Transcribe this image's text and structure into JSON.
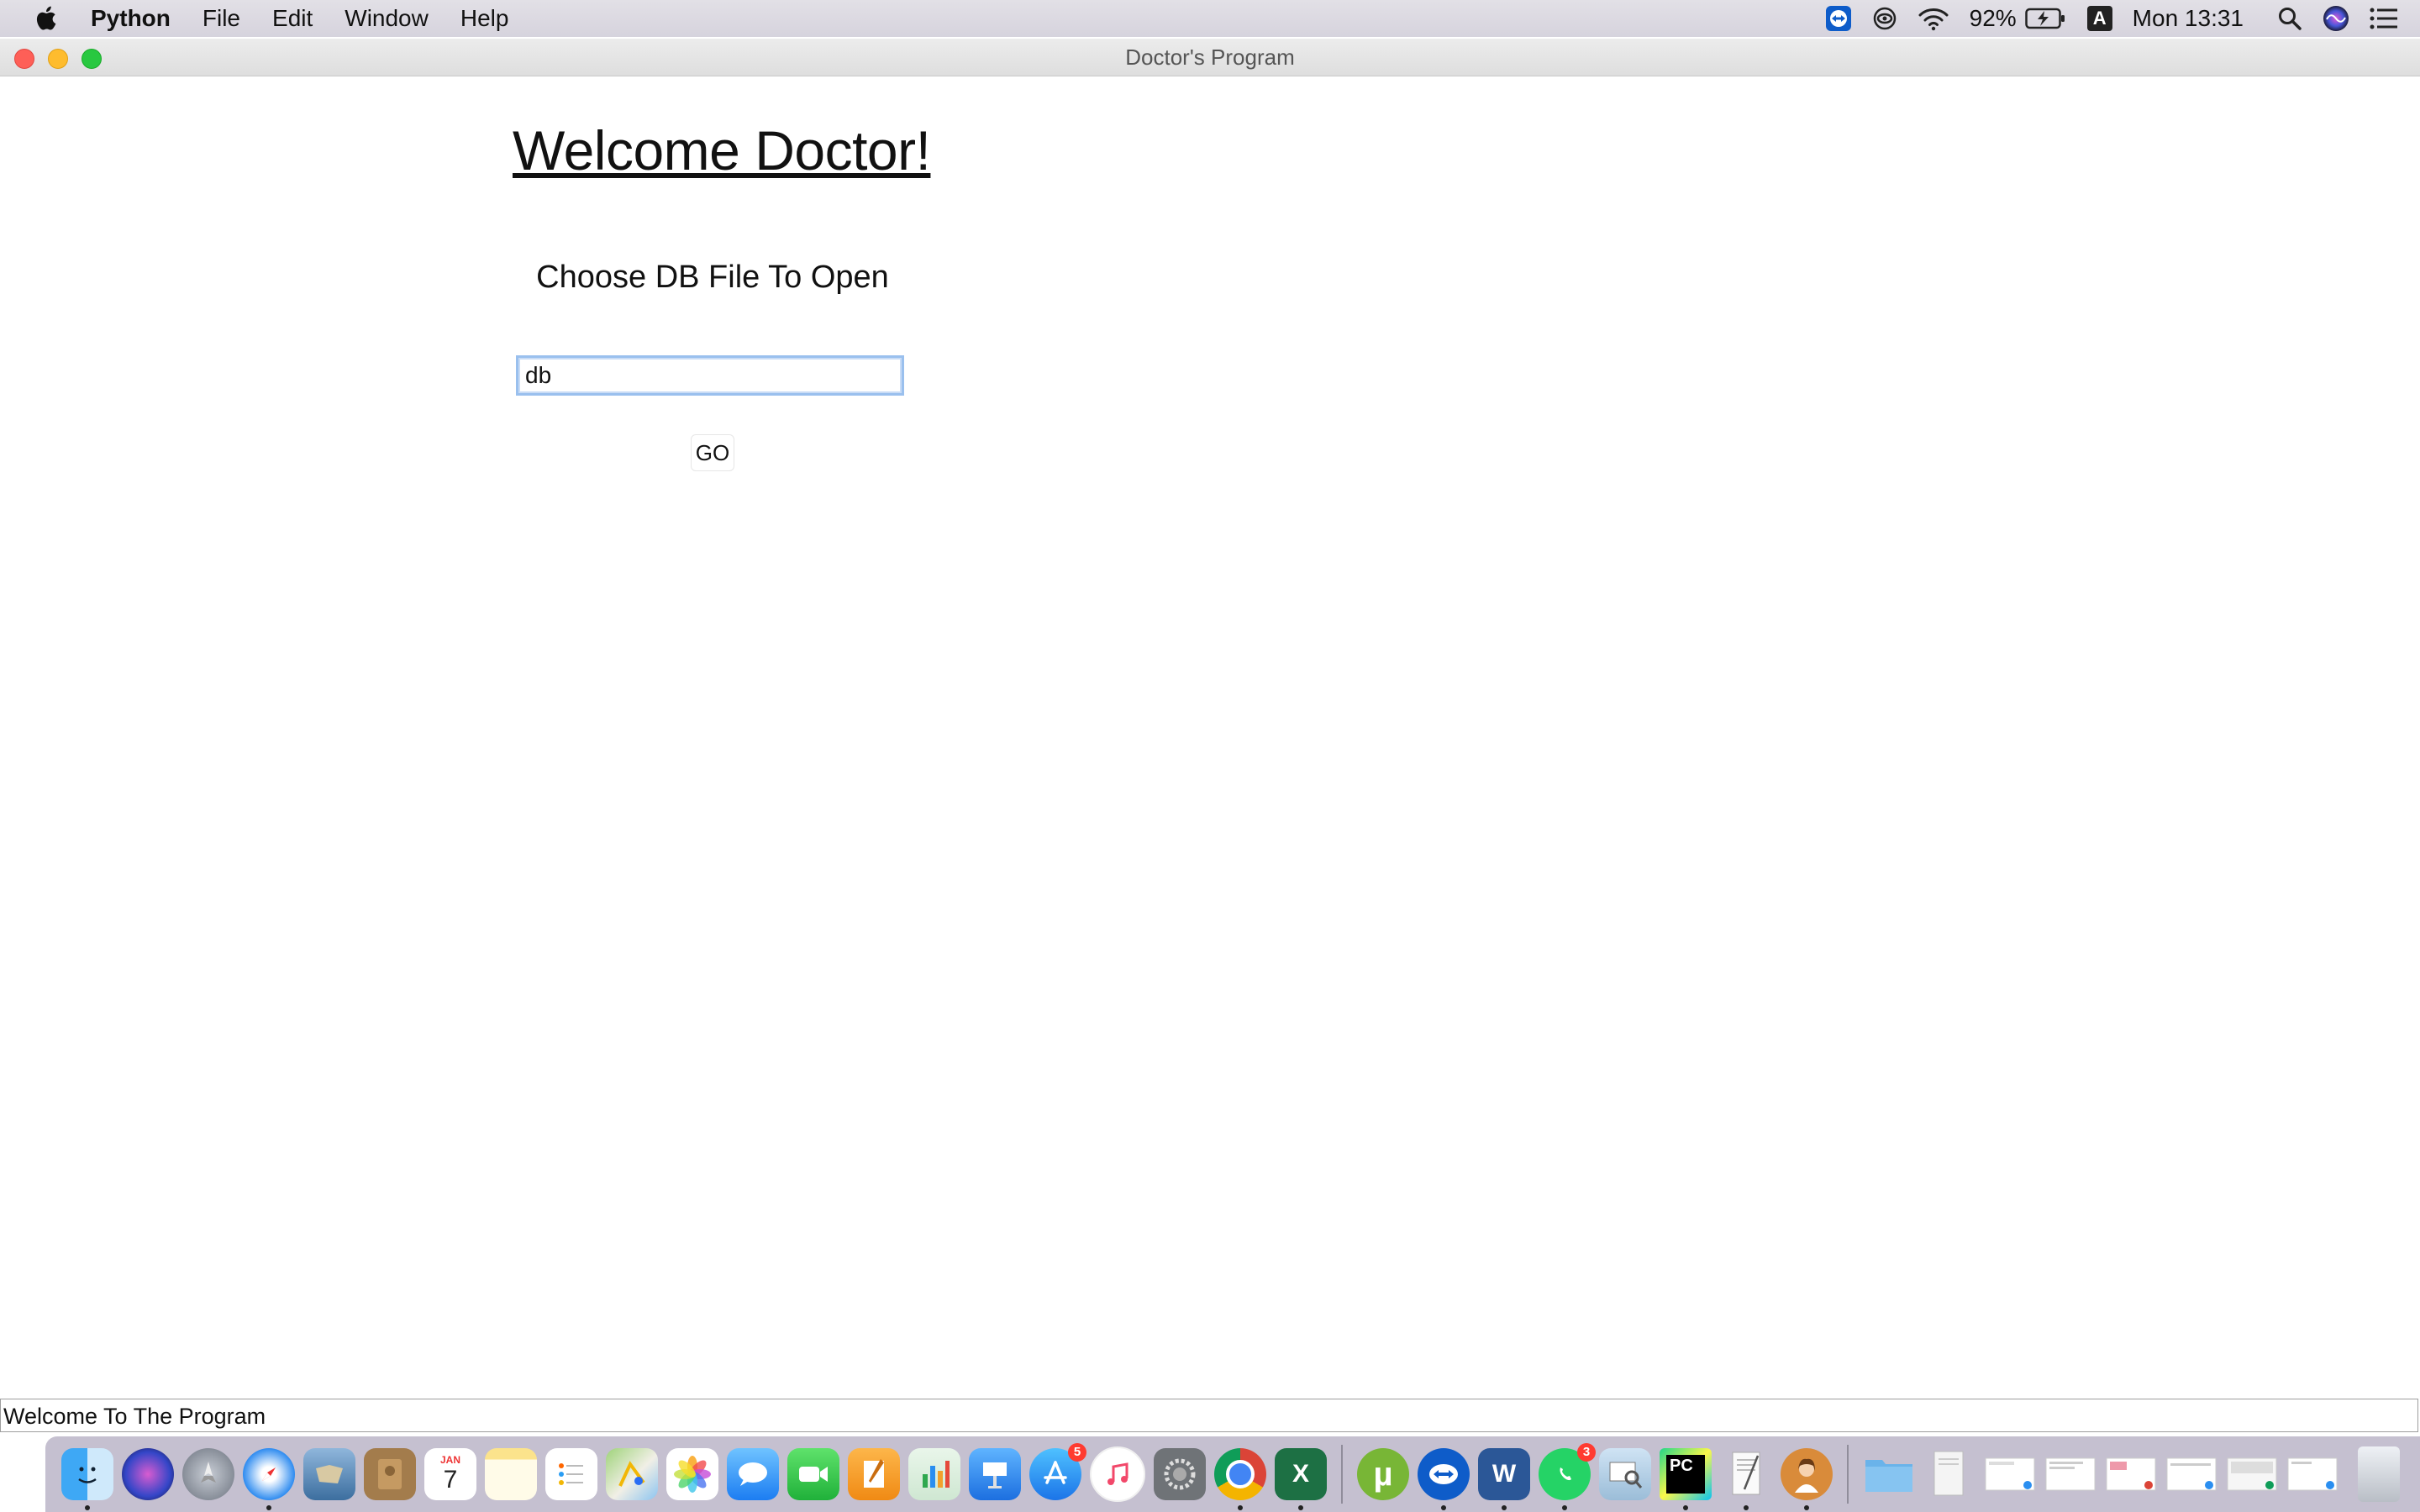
{
  "menubar": {
    "app_name": "Python",
    "items": [
      "File",
      "Edit",
      "Window",
      "Help"
    ],
    "battery": "92%",
    "input_source": "A",
    "clock": "Mon 13:31"
  },
  "window": {
    "title": "Doctor's Program"
  },
  "main": {
    "heading": "Welcome Doctor!",
    "prompt": "Choose DB File To Open",
    "file_input_value": "db",
    "go_label": "GO"
  },
  "statusbar": {
    "text": "Welcome To The Program"
  },
  "dock": {
    "badges": {
      "app_store": "5",
      "whatsapp": "3"
    },
    "apps": [
      "finder",
      "siri",
      "launchpad",
      "safari",
      "mail",
      "contacts",
      "calendar",
      "notes",
      "reminders",
      "maps",
      "photos",
      "messages",
      "facetime",
      "pages",
      "numbers",
      "keynote",
      "app-store",
      "music",
      "system-preferences",
      "chrome",
      "excel",
      "utorrent",
      "teamviewer",
      "word",
      "whatsapp",
      "preview",
      "pycharm",
      "textedit",
      "avatar-app"
    ],
    "calendar_month": "JAN",
    "calendar_day": "7"
  },
  "colors": {
    "accent_focus": "#9ac0ee",
    "close": "#fe5f57",
    "minimize": "#febc2e",
    "maximize": "#28c840"
  }
}
